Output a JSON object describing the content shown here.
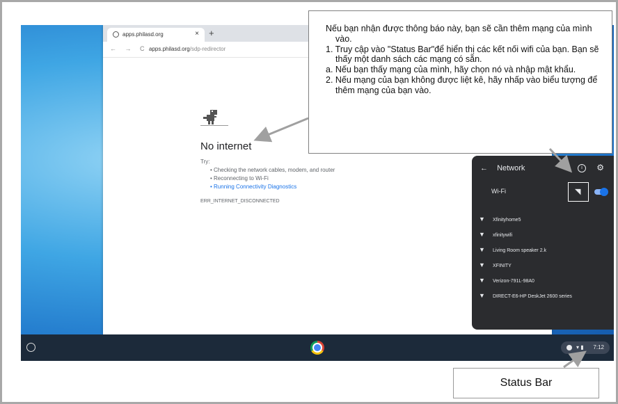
{
  "browser": {
    "tab_title": "apps.philasd.org",
    "tab_close": "×",
    "new_tab": "+",
    "nav": "← → C",
    "url_host": "apps.philasd.org",
    "url_path": "/sdp-redirector"
  },
  "error_page": {
    "title": "No internet",
    "try_label": "Try:",
    "tips": [
      "Checking the network cables, modem, and router",
      "Reconnecting to Wi-Fi",
      "Running Connectivity Diagnostics"
    ],
    "code": "ERR_INTERNET_DISCONNECTED"
  },
  "network_panel": {
    "back": "←",
    "title": "Network",
    "info": "i",
    "gear": "⚙",
    "wifi_label": "Wi-Fi",
    "wifi_on": true,
    "networks": [
      "Xfinityhome5",
      "xfinitywifi",
      "Living Room speaker 2.k",
      "XFINITY",
      "Verizon-791L-98A0",
      "DIRECT-E6-HP DeskJet 2600 series"
    ]
  },
  "shelf": {
    "clock": "7:12",
    "tray_icons": "▾ ▮"
  },
  "callout": {
    "intro": "Nếu bạn nhận được thông báo này, bạn sẽ cần thêm mạng của mình vào.",
    "step1": "1. Truy cập vào \"Status Bar\"để hiển thị các kết nối wifi của bạn. Bạn sẽ thấy một danh sách các mạng có sẵn.",
    "step1a": "a. Nếu bạn thấy mạng của mình, hãy chọn nó và nhập mật khẩu.",
    "step2": "2. Nếu mạng của bạn không được liệt kê, hãy nhấp vào biểu tượng để thêm mạng của bạn vào."
  },
  "status_label": "Status Bar",
  "colors": {
    "shelf": "#1c2a3a",
    "accent": "#1a73e8",
    "panel": "#2b2c2f"
  }
}
